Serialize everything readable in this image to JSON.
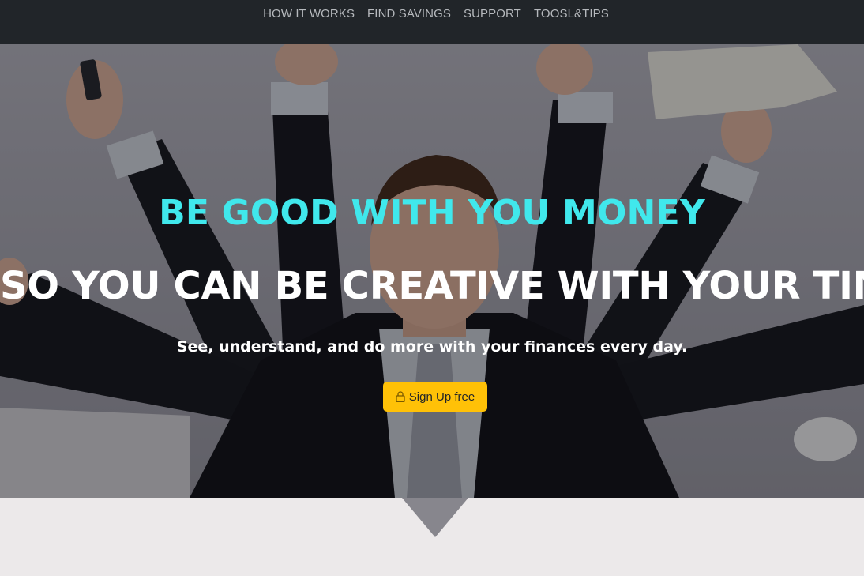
{
  "nav": {
    "items": [
      {
        "label": "HOW IT WORKS"
      },
      {
        "label": "FIND SAVINGS"
      },
      {
        "label": "SUPPORT"
      },
      {
        "label": "TOOSL&TIPS"
      }
    ]
  },
  "hero": {
    "headline": "BE GOOD WITH YOU MONEY",
    "subheadline": "SO YOU CAN BE CREATIVE WITH YOUR TIME",
    "tagline": "See, understand, and do more with your finances every day.",
    "cta_label": "Sign Up free",
    "cta_icon": "lock-icon"
  },
  "colors": {
    "navbar_bg": "#212529",
    "accent_headline": "#40e8ec",
    "cta_bg": "#ffc107",
    "section_bg": "#ece9ea"
  }
}
